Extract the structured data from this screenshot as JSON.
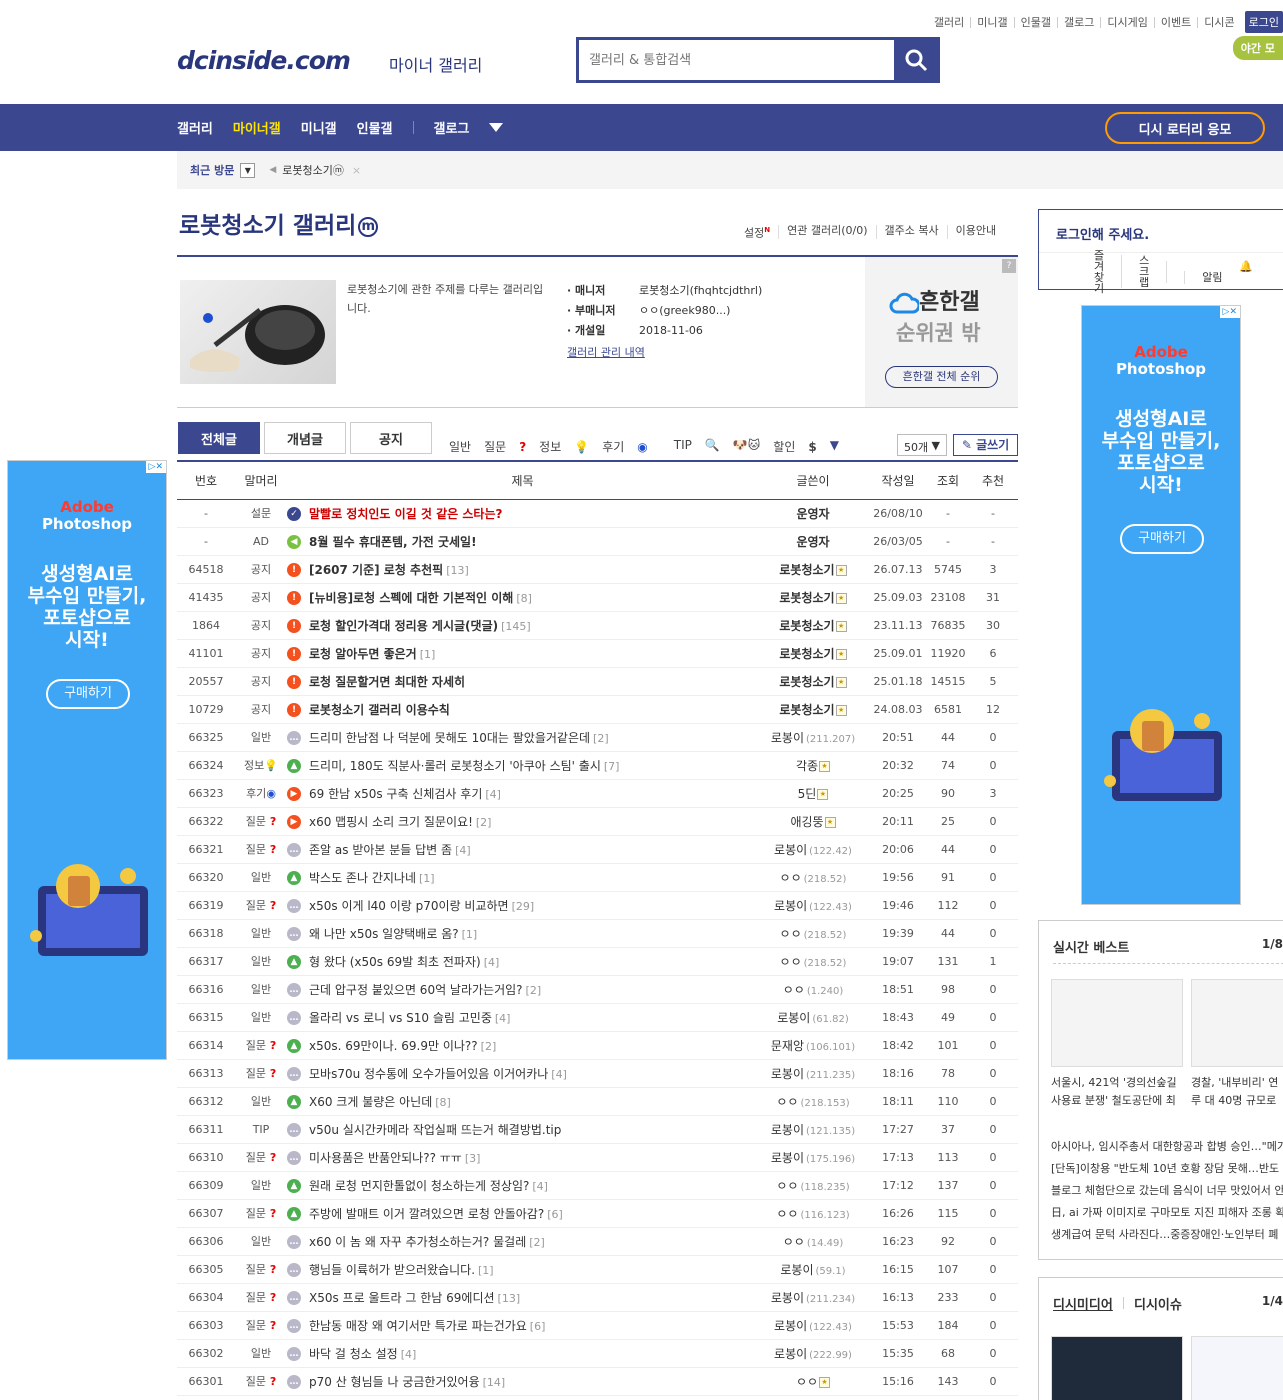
{
  "topnav": [
    "갤러리",
    "미니갤",
    "인물갤",
    "갤로그",
    "디시게임",
    "이벤트",
    "디시콘"
  ],
  "login_label": "로그인",
  "night_mode": "야간 모",
  "logo": "dcinside.com",
  "logo_sub": "마이너 갤러리",
  "search_placeholder": "갤러리 & 통합검색",
  "gnb": {
    "items": [
      "갤러리",
      "마이너갤",
      "미니갤",
      "인물갤"
    ],
    "gallog": "갤로그",
    "lottery": "디시 로터리 응모"
  },
  "visit": {
    "label": "최근 방문",
    "item": "로봇청소기ⓜ"
  },
  "gallery": {
    "title": "로봇청소기 갤러리",
    "mark": "m",
    "options": [
      "설정",
      "연관 갤러리(0/0)",
      "갤주소 복사",
      "이용안내"
    ],
    "option_new": "N",
    "description": "로봇청소기에 관한 주제를 다루는 갤러리입니다.",
    "manager_label": "매니저",
    "manager": "로봇청소기(fhqhtcjdthrl)",
    "submanager_label": "부매니저",
    "submanager": "ㅇㅇ(greek980...)",
    "opened_label": "개설일",
    "opened": "2018-11-06",
    "admin_link": "갤러리 관리 내역"
  },
  "rank": {
    "q": "?",
    "line1": "흔한갤",
    "line2": "순위권 밖",
    "button": "흔한갤 전체 순위"
  },
  "tabs": [
    "전체글",
    "개념글",
    "공지"
  ],
  "heads": [
    "일반",
    "질문",
    "정보",
    "후기",
    "TIP",
    "할인"
  ],
  "list_count": "50개",
  "write": "글쓰기",
  "columns": [
    "번호",
    "말머리",
    "제목",
    "글쓴이",
    "작성일",
    "조회",
    "추천"
  ],
  "rows": [
    {
      "no": "-",
      "head": "설문",
      "title": "말빨로 정치인도 이길 것 같은 스타는?",
      "cmt": "",
      "writer": "운영자",
      "ip": "",
      "date": "26/08/10",
      "views": "-",
      "rec": "-",
      "icon": "survey",
      "style": "red"
    },
    {
      "no": "-",
      "head": "AD",
      "title": "8월 필수 휴대폰템, 가전 굿세일!",
      "cmt": "",
      "writer": "운영자",
      "ip": "",
      "date": "26/03/05",
      "views": "-",
      "rec": "-",
      "icon": "ad",
      "style": "bold"
    },
    {
      "no": "64518",
      "head": "공지",
      "title": "[2607 기준] 로청 추천픽",
      "cmt": "[13]",
      "writer": "로봇청소기",
      "ip": "",
      "date": "26.07.13",
      "views": "5745",
      "rec": "3",
      "icon": "notice",
      "style": "bold",
      "badge": true
    },
    {
      "no": "41435",
      "head": "공지",
      "title": "[뉴비용]로청 스펙에 대한 기본적인 이해",
      "cmt": "[8]",
      "writer": "로봇청소기",
      "ip": "",
      "date": "25.09.03",
      "views": "23108",
      "rec": "31",
      "icon": "notice",
      "style": "bold",
      "badge": true
    },
    {
      "no": "1864",
      "head": "공지",
      "title": "로청 할인가격대 정리용 게시글(댓글)",
      "cmt": "[145]",
      "writer": "로봇청소기",
      "ip": "",
      "date": "23.11.13",
      "views": "76835",
      "rec": "30",
      "icon": "notice",
      "style": "bold",
      "badge": true
    },
    {
      "no": "41101",
      "head": "공지",
      "title": "로청 알아두면 좋은거",
      "cmt": "[1]",
      "writer": "로봇청소기",
      "ip": "",
      "date": "25.09.01",
      "views": "11920",
      "rec": "6",
      "icon": "notice",
      "style": "bold",
      "badge": true
    },
    {
      "no": "20557",
      "head": "공지",
      "title": "로청 질문할거면 최대한 자세히",
      "cmt": "",
      "writer": "로봇청소기",
      "ip": "",
      "date": "25.01.18",
      "views": "14515",
      "rec": "5",
      "icon": "notice",
      "style": "bold",
      "badge": true
    },
    {
      "no": "10729",
      "head": "공지",
      "title": "로봇청소기 갤러리 이용수칙",
      "cmt": "",
      "writer": "로봇청소기",
      "ip": "",
      "date": "24.08.03",
      "views": "6581",
      "rec": "12",
      "icon": "notice",
      "style": "bold",
      "badge": true
    },
    {
      "no": "66325",
      "head": "일반",
      "title": "드리미 한남점 나 덕분에 못해도 10대는 팔았을거같은데",
      "cmt": "[2]",
      "writer": "로봉이",
      "ip": "(211.207)",
      "date": "20:51",
      "views": "44",
      "rec": "0",
      "icon": "text"
    },
    {
      "no": "66324",
      "head": "정보",
      "title": "드리미, 180도 직분사·롤러 로봇청소기 '아쿠아 스팀' 출시",
      "cmt": "[7]",
      "writer": "각종",
      "ip": "",
      "date": "20:32",
      "views": "74",
      "rec": "0",
      "icon": "image",
      "badge": true
    },
    {
      "no": "66323",
      "head": "후기",
      "title": "69 한남 x50s 구축 신체검사 후기",
      "cmt": "[4]",
      "writer": "5딘",
      "ip": "",
      "date": "20:25",
      "views": "90",
      "rec": "3",
      "icon": "video",
      "badge": true
    },
    {
      "no": "66322",
      "head": "질문",
      "title": "x60 맵핑시 소리 크기 질문이요!",
      "cmt": "[2]",
      "writer": "애깅뚱",
      "ip": "",
      "date": "20:11",
      "views": "25",
      "rec": "0",
      "icon": "video",
      "badge": true
    },
    {
      "no": "66321",
      "head": "질문",
      "title": "존알 as 받아본 분들 답변 좀",
      "cmt": "[4]",
      "writer": "로봉이",
      "ip": "(122.42)",
      "date": "20:06",
      "views": "44",
      "rec": "0",
      "icon": "text"
    },
    {
      "no": "66320",
      "head": "일반",
      "title": "박스도 존나 간지나네",
      "cmt": "[1]",
      "writer": "ㅇㅇ",
      "ip": "(218.52)",
      "date": "19:56",
      "views": "91",
      "rec": "0",
      "icon": "image"
    },
    {
      "no": "66319",
      "head": "질문",
      "title": "x50s 이게 l40 이랑 p70이랑 비교하면",
      "cmt": "[29]",
      "writer": "로봉이",
      "ip": "(122.43)",
      "date": "19:46",
      "views": "112",
      "rec": "0",
      "icon": "text"
    },
    {
      "no": "66318",
      "head": "일반",
      "title": "왜 나만 x50s 일양택배로 옴?",
      "cmt": "[1]",
      "writer": "ㅇㅇ",
      "ip": "(218.52)",
      "date": "19:39",
      "views": "44",
      "rec": "0",
      "icon": "text"
    },
    {
      "no": "66317",
      "head": "일반",
      "title": "형 왔다 (x50s 69발 최초 전파자)",
      "cmt": "[4]",
      "writer": "ㅇㅇ",
      "ip": "(218.52)",
      "date": "19:07",
      "views": "131",
      "rec": "1",
      "icon": "image"
    },
    {
      "no": "66316",
      "head": "일반",
      "title": "근데 압구정 붙있으면 60억 날라가는거임?",
      "cmt": "[2]",
      "writer": "ㅇㅇ",
      "ip": "(1.240)",
      "date": "18:51",
      "views": "98",
      "rec": "0",
      "icon": "text"
    },
    {
      "no": "66315",
      "head": "일반",
      "title": "올라리 vs 로니 vs S10 슬림 고민중",
      "cmt": "[4]",
      "writer": "로봉이",
      "ip": "(61.82)",
      "date": "18:43",
      "views": "49",
      "rec": "0",
      "icon": "text"
    },
    {
      "no": "66314",
      "head": "질문",
      "title": "x50s. 69만이나. 69.9만 이나??",
      "cmt": "[2]",
      "writer": "문재앙",
      "ip": "(106.101)",
      "date": "18:42",
      "views": "101",
      "rec": "0",
      "icon": "image"
    },
    {
      "no": "66313",
      "head": "질문",
      "title": "모바s70u 정수통에 오수가들어있음 이거어카나",
      "cmt": "[4]",
      "writer": "로봉이",
      "ip": "(211.235)",
      "date": "18:16",
      "views": "78",
      "rec": "0",
      "icon": "text"
    },
    {
      "no": "66312",
      "head": "일반",
      "title": "X60 크게 불량은 아닌데",
      "cmt": "[8]",
      "writer": "ㅇㅇ",
      "ip": "(218.153)",
      "date": "18:11",
      "views": "110",
      "rec": "0",
      "icon": "image"
    },
    {
      "no": "66311",
      "head": "TIP",
      "title": "v50u 실시간카메라 작업실패 뜨는거 해결방법.tip",
      "cmt": "",
      "writer": "로봉이",
      "ip": "(121.135)",
      "date": "17:27",
      "views": "37",
      "rec": "0",
      "icon": "text"
    },
    {
      "no": "66310",
      "head": "질문",
      "title": "미사용품은 반품안되나?? ㅠㅠ",
      "cmt": "[3]",
      "writer": "로봉이",
      "ip": "(175.196)",
      "date": "17:13",
      "views": "113",
      "rec": "0",
      "icon": "text"
    },
    {
      "no": "66309",
      "head": "일반",
      "title": "원래 로청 먼지한톨없이 청소하는게 정상임?",
      "cmt": "[4]",
      "writer": "ㅇㅇ",
      "ip": "(118.235)",
      "date": "17:12",
      "views": "137",
      "rec": "0",
      "icon": "image"
    },
    {
      "no": "66307",
      "head": "질문",
      "title": "주방에 발매트 이거 깔려있으면 로청 안돌아감?",
      "cmt": "[6]",
      "writer": "ㅇㅇ",
      "ip": "(116.123)",
      "date": "16:26",
      "views": "115",
      "rec": "0",
      "icon": "image"
    },
    {
      "no": "66306",
      "head": "일반",
      "title": "x60 이 놈 왜 자꾸 추가청소하는거? 물걸레",
      "cmt": "[2]",
      "writer": "ㅇㅇ",
      "ip": "(14.49)",
      "date": "16:23",
      "views": "92",
      "rec": "0",
      "icon": "text"
    },
    {
      "no": "66305",
      "head": "질문",
      "title": "행님들 이륙허가 받으러왔습니다.",
      "cmt": "[1]",
      "writer": "로봉이",
      "ip": "(59.1)",
      "date": "16:15",
      "views": "107",
      "rec": "0",
      "icon": "text"
    },
    {
      "no": "66304",
      "head": "질문",
      "title": "X50s 프로 울트라 그 한남 69에디션",
      "cmt": "[13]",
      "writer": "로봉이",
      "ip": "(211.234)",
      "date": "16:13",
      "views": "233",
      "rec": "0",
      "icon": "text"
    },
    {
      "no": "66303",
      "head": "질문",
      "title": "한남동 매장 왜 여기서만 특가로 파는건가요",
      "cmt": "[6]",
      "writer": "로봉이",
      "ip": "(122.43)",
      "date": "15:53",
      "views": "184",
      "rec": "0",
      "icon": "text"
    },
    {
      "no": "66302",
      "head": "일반",
      "title": "바닥 걸 청소 설정",
      "cmt": "[4]",
      "writer": "로봉이",
      "ip": "(222.99)",
      "date": "15:35",
      "views": "68",
      "rec": "0",
      "icon": "text"
    },
    {
      "no": "66301",
      "head": "질문",
      "title": "p70 산 형님들 나 궁금한거있어융",
      "cmt": "[14]",
      "writer": "ㅇㅇ",
      "ip": "",
      "date": "15:16",
      "views": "143",
      "rec": "0",
      "icon": "text",
      "badge": true
    }
  ],
  "ad": {
    "about": "▷✕",
    "brand1": "Adobe",
    "brand2": "Photoshop",
    "copy": [
      "생성형AI로",
      "부수입 만들기,",
      "포토샵으로",
      "시작!"
    ],
    "cta": "구매하기"
  },
  "loginbox": {
    "title": "로그인해 주세요.",
    "links": [
      "즐겨찾기",
      "스크랩",
      "알림"
    ]
  },
  "best": {
    "title": "실시간 베스트",
    "page": "1/8",
    "captions": [
      "서울시, 421억 '경의선숲길 사용료 분쟁' 철도공단에 최",
      "경찰, '내부비리' 연루 대 40명 규모로 구속"
    ],
    "items": [
      "아시아나, 임시주총서 대한항공과 합병 승인…\"메가",
      "[단독]이창용 \"반도체 10년 호황 장담 못해…반도",
      "블로그 체험단으로 갔는데 음식이 너무 맛있어서 안",
      "日, ai 가짜 이미지로 구마모토 지진 피해자 조롱 확",
      "생계급여 문턱 사라진다…중증장애인·노인부터 폐"
    ]
  },
  "media": {
    "tab1": "디시미디어",
    "tab2": "디시이슈",
    "page": "1/4"
  }
}
